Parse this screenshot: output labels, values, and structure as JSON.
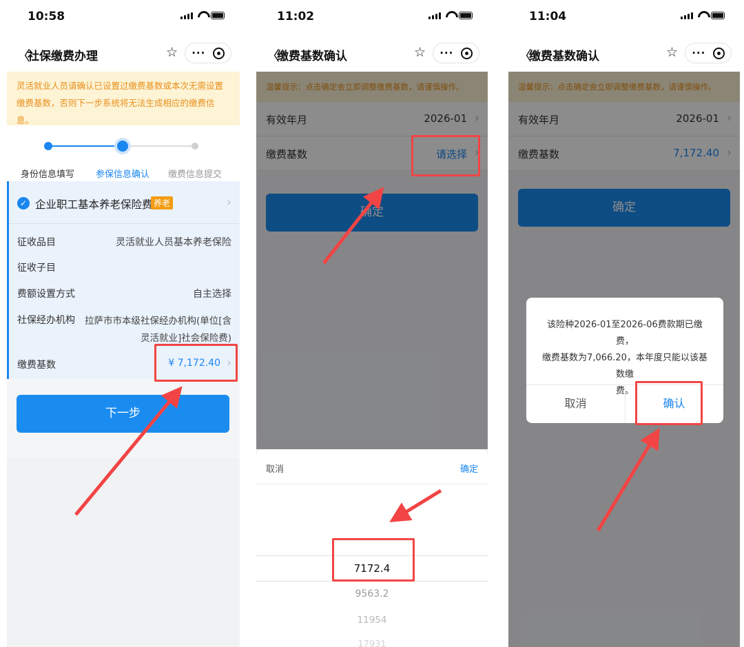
{
  "screen1": {
    "time": "10:58",
    "nav_title": "社保缴费办理",
    "notice": "灵活就业人员请确认已设置过缴费基数或本次无需设置缴费基数，否则下一步系统将无法生成相应的缴费信息。",
    "steps": [
      {
        "label": "身份信息填写",
        "state": "done"
      },
      {
        "label": "参保信息确认",
        "state": "active"
      },
      {
        "label": "缴费信息提交",
        "state": "pending"
      }
    ],
    "insurance": {
      "name": "企业职工基本养老保险费",
      "tag": "养老",
      "rows": [
        {
          "key": "征收品目",
          "value": "灵活就业人员基本养老保险"
        },
        {
          "key": "征收子目",
          "value": ""
        },
        {
          "key": "费额设置方式",
          "value": "自主选择"
        },
        {
          "key": "社保经办机构",
          "value": "拉萨市市本级社保经办机构(单位[含",
          "value2": "灵活就业]社会保险费)"
        }
      ],
      "base_label": "缴费基数",
      "base_value": "¥ 7,172.40"
    },
    "next_button": "下一步"
  },
  "screen2": {
    "time": "11:02",
    "nav_title": "缴费基数确认",
    "notice": "温馨提示：点击确定会立即调整缴费基数，请谨慎操作。",
    "rows": [
      {
        "key": "有效年月",
        "value": "2026-01"
      },
      {
        "key": "缴费基数",
        "value": "请选择"
      }
    ],
    "confirm_button": "确定",
    "sheet": {
      "cancel": "取消",
      "ok": "确定",
      "options": [
        "7172.4",
        "9563.2",
        "11954",
        "17931"
      ],
      "selected": "7172.4"
    }
  },
  "screen3": {
    "time": "11:04",
    "nav_title": "缴费基数确认",
    "notice": "温馨提示：点击确定会立即调整缴费基数，请谨慎操作。",
    "rows": [
      {
        "key": "有效年月",
        "value": "2026-01"
      },
      {
        "key": "缴费基数",
        "value": "7,172.40"
      }
    ],
    "confirm_button": "确定",
    "dialog": {
      "line1": "该险种2026-01至2026-06费款期已缴费，",
      "line2": "缴费基数为7,066.20，本年度只能以该基数缴",
      "line3": "费。",
      "cancel": "取消",
      "confirm": "确认"
    }
  },
  "colors": {
    "brand_blue": "#1a8cf0",
    "notice_bg": "#fdf3d5",
    "notice_text": "#e8901d",
    "highlight_red": "#f24444",
    "tag_orange": "#f39c12"
  }
}
